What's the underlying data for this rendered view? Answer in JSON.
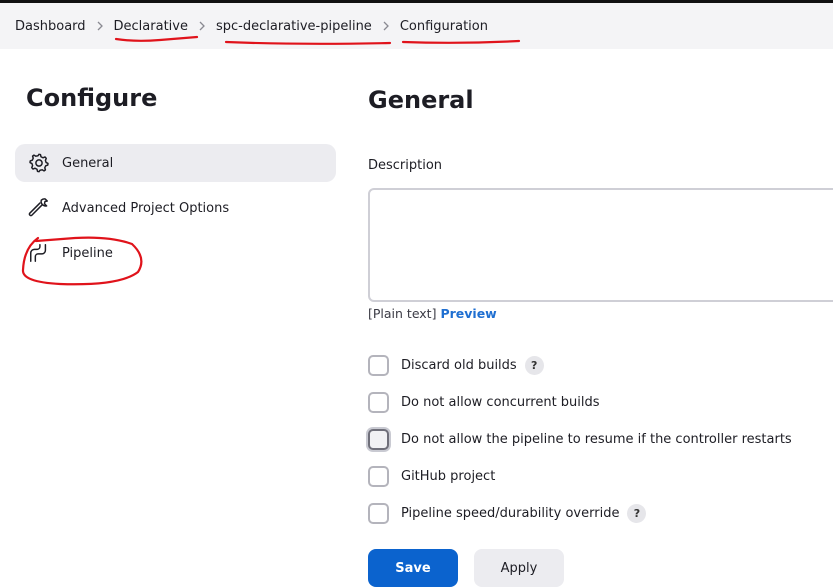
{
  "breadcrumb": [
    {
      "label": "Dashboard"
    },
    {
      "label": "Declarative"
    },
    {
      "label": "spc-declarative-pipeline"
    },
    {
      "label": "Configuration"
    }
  ],
  "sidebar": {
    "title": "Configure",
    "items": [
      {
        "label": "General",
        "icon": "gear-icon",
        "active": true
      },
      {
        "label": "Advanced Project Options",
        "icon": "wrench-icon",
        "active": false
      },
      {
        "label": "Pipeline",
        "icon": "pipeline-icon",
        "active": false
      }
    ]
  },
  "main": {
    "title": "General",
    "description": {
      "label": "Description",
      "value": "",
      "format_text": "[Plain text]",
      "preview_label": "Preview"
    },
    "options": [
      {
        "label": "Discard old builds",
        "checked": false,
        "help": true
      },
      {
        "label": "Do not allow concurrent builds",
        "checked": false,
        "help": false
      },
      {
        "label": "Do not allow the pipeline to resume if the controller restarts",
        "checked": false,
        "help": false
      },
      {
        "label": "GitHub project",
        "checked": false,
        "help": false
      },
      {
        "label": "Pipeline speed/durability override",
        "checked": false,
        "help": true
      }
    ],
    "help_glyph": "?"
  },
  "buttons": {
    "save": "Save",
    "apply": "Apply"
  },
  "colors": {
    "accent": "#0b63ce",
    "link": "#1f6fd1",
    "annotation": "#e0131b"
  }
}
